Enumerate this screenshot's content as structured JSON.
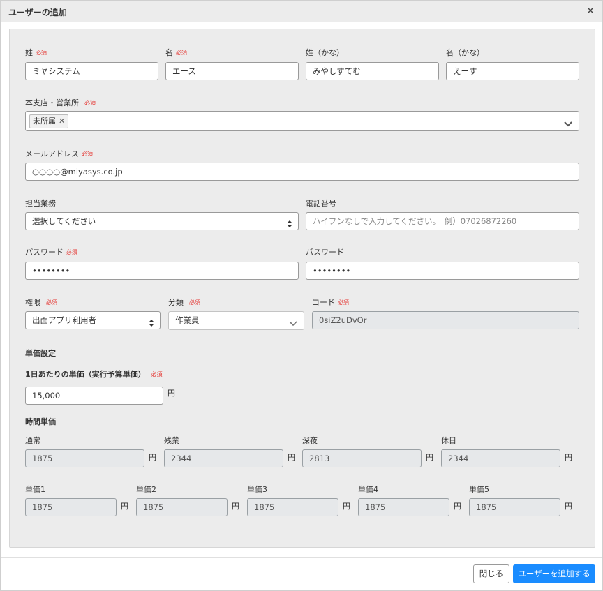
{
  "dialog": {
    "title": "ユーザーの追加"
  },
  "required_mark": "必須",
  "name": {
    "sei_label": "姓",
    "sei_value": "ミヤシステム",
    "mei_label": "名",
    "mei_value": "エース",
    "sei_kana_label": "姓（かな）",
    "sei_kana_value": "みやしすてむ",
    "mei_kana_label": "名（かな）",
    "mei_kana_value": "えーす"
  },
  "branch": {
    "label": "本支店・営業所",
    "tag": "未所属"
  },
  "email": {
    "label": "メールアドレス",
    "value": "○○○○@miyasys.co.jp"
  },
  "duty": {
    "label": "担当業務",
    "value": "選択してください"
  },
  "phone": {
    "label": "電話番号",
    "placeholder": "ハイフンなしで入力してください。　例）07026872260"
  },
  "password": {
    "label": "パスワード",
    "value": "••••••••",
    "confirm_label": "パスワード",
    "confirm_value": "••••••••"
  },
  "authority": {
    "label": "権限",
    "value": "出面アプリ利用者"
  },
  "category": {
    "label": "分類",
    "value": "作業員"
  },
  "code": {
    "label": "コード",
    "value": "0siZ2uDvOr"
  },
  "unit_price": {
    "section_title": "単価設定",
    "daily_label": "1日あたりの単価（実行予算単価）",
    "daily_value": "15,000",
    "currency": "円",
    "hourly_title": "時間単価",
    "hourly": [
      {
        "label": "通常",
        "value": "1875"
      },
      {
        "label": "残業",
        "value": "2344"
      },
      {
        "label": "深夜",
        "value": "2813"
      },
      {
        "label": "休日",
        "value": "2344"
      }
    ],
    "extra": [
      {
        "label": "単価1",
        "value": "1875"
      },
      {
        "label": "単価2",
        "value": "1875"
      },
      {
        "label": "単価3",
        "value": "1875"
      },
      {
        "label": "単価4",
        "value": "1875"
      },
      {
        "label": "単価5",
        "value": "1875"
      }
    ]
  },
  "footer": {
    "close_label": "閉じる",
    "add_label": "ユーザーを追加する"
  },
  "icons": {
    "close": "close-icon",
    "select": "select-arrows-icon",
    "dropdown": "chevron-down-icon",
    "tag_remove": "tag-remove-icon"
  },
  "colors": {
    "required": "#e53935",
    "primary": "#1a8cff",
    "panel": "#ececec"
  }
}
